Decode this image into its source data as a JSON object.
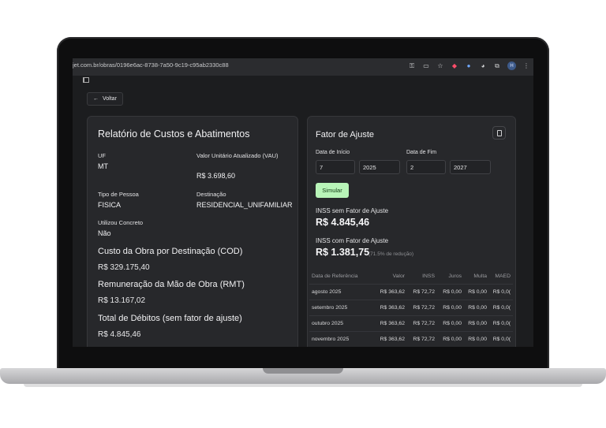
{
  "browser": {
    "url": "jet.com.br/obras/0196e6ac-8738-7a50-9c19-c95ab2330c88",
    "avatar_letter": "H"
  },
  "back_button": {
    "label": "Voltar"
  },
  "report": {
    "title": "Relatório de Custos e Abatimentos",
    "uf_label": "UF",
    "uf_value": "MT",
    "vau_label": "Valor Unitário Atualizado (VAU)",
    "vau_value": "R$ 3.698,60",
    "tipo_label": "Tipo de Pessoa",
    "tipo_value": "FISICA",
    "destinacao_label": "Destinação",
    "destinacao_value": "RESIDENCIAL_UNIFAMILIAR",
    "concreto_label": "Utilizou Concreto",
    "concreto_value": "Não",
    "cod_title": "Custo da Obra por Destinação (COD)",
    "cod_value": "R$ 329.175,40",
    "rmt_title": "Remuneração da Mão de Obra (RMT)",
    "rmt_value": "R$ 13.167,02",
    "debitos_title": "Total de Débitos (sem fator de ajuste)",
    "debitos_value": "R$ 4.845,46"
  },
  "fator": {
    "title": "Fator de Ajuste",
    "inicio_label": "Data de Início",
    "fim_label": "Data de Fim",
    "inicio_mes": "7",
    "inicio_ano": "2025",
    "fim_mes": "2",
    "fim_ano": "2027",
    "simular_label": "Simular",
    "sem_label": "INSS sem Fator de Ajuste",
    "sem_value": "R$ 4.845,46",
    "com_label": "INSS com Fator de Ajuste",
    "com_value": "R$ 1.381,75",
    "reducao": "(71.5% de redução)"
  },
  "table": {
    "headers": [
      "Data de Referência",
      "Valor",
      "INSS",
      "Juros",
      "Multa",
      "MAED"
    ],
    "rows": [
      [
        "agosto 2025",
        "R$ 363,62",
        "R$ 72,72",
        "R$ 0,00",
        "R$ 0,00",
        "R$ 0,0("
      ],
      [
        "setembro 2025",
        "R$ 363,62",
        "R$ 72,72",
        "R$ 0,00",
        "R$ 0,00",
        "R$ 0,0("
      ],
      [
        "outubro 2025",
        "R$ 363,62",
        "R$ 72,72",
        "R$ 0,00",
        "R$ 0,00",
        "R$ 0,0("
      ],
      [
        "novembro 2025",
        "R$ 363,62",
        "R$ 72,72",
        "R$ 0,00",
        "R$ 0,00",
        "R$ 0,0("
      ]
    ]
  },
  "colors": {
    "accent_button": "#b8f4b8",
    "card_bg": "#27282b",
    "page_bg": "#1c1d1f"
  }
}
